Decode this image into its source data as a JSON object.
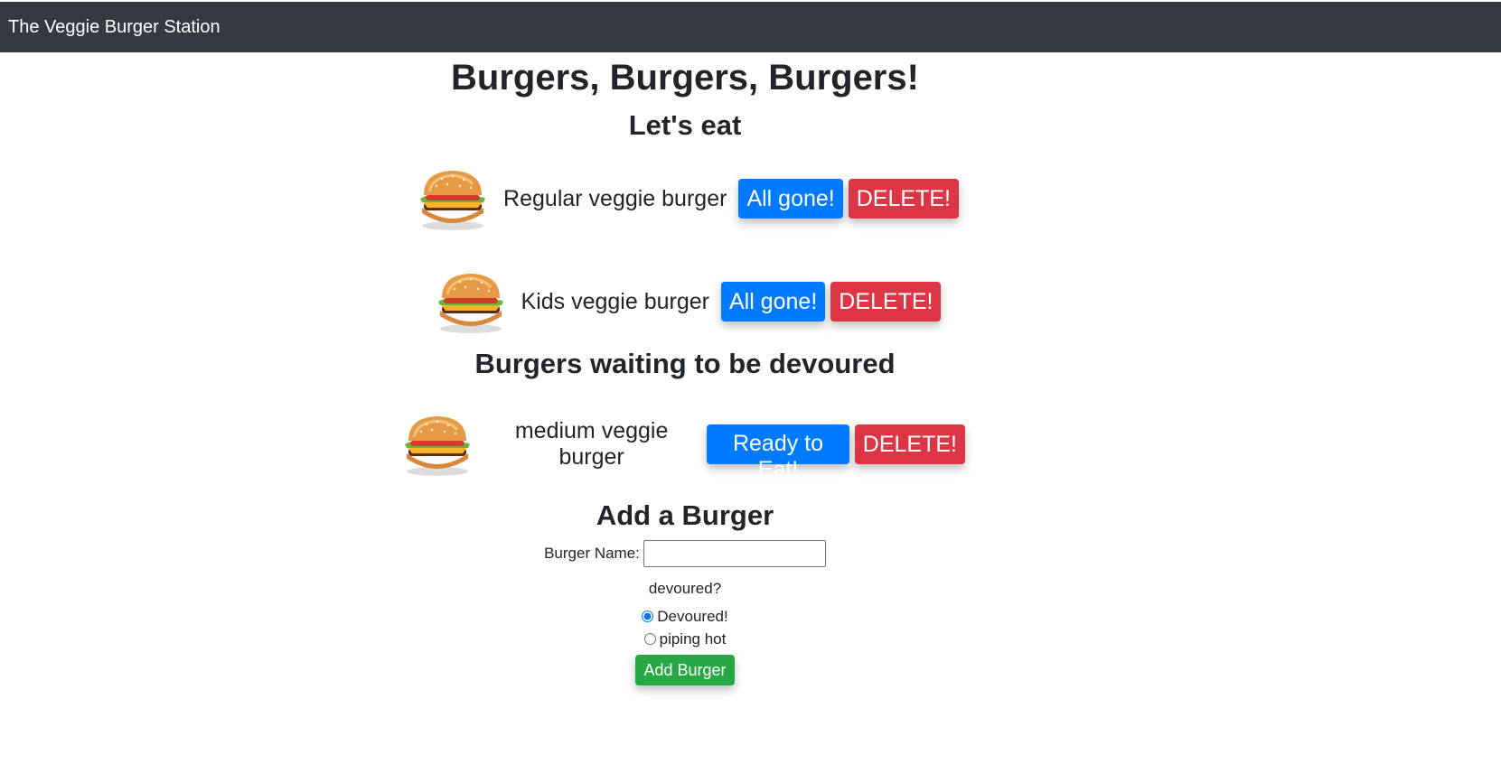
{
  "navbar": {
    "brand": "The Veggie Burger Station"
  },
  "header": {
    "title": "Burgers, Burgers, Burgers!",
    "subtitle": "Let's eat"
  },
  "devoured_list": [
    {
      "name": "Regular veggie burger",
      "primary_button": "All gone!",
      "delete_button": "DELETE!"
    },
    {
      "name": "Kids veggie burger",
      "primary_button": "All gone!",
      "delete_button": "DELETE!"
    }
  ],
  "waiting_section": {
    "title": "Burgers waiting to be devoured",
    "items": [
      {
        "name": "medium veggie burger",
        "primary_button": "Ready to Eat!",
        "delete_button": "DELETE!"
      }
    ]
  },
  "add_form": {
    "title": "Add a Burger",
    "name_label": "Burger Name:",
    "name_value": "",
    "devoured_question": "devoured?",
    "options": [
      {
        "label": "Devoured!",
        "checked": true
      },
      {
        "label": "piping hot",
        "checked": false
      }
    ],
    "submit_label": "Add Burger"
  },
  "colors": {
    "navbar": "#343a40",
    "primary": "#007bff",
    "danger": "#dc3545",
    "success": "#28a745"
  }
}
